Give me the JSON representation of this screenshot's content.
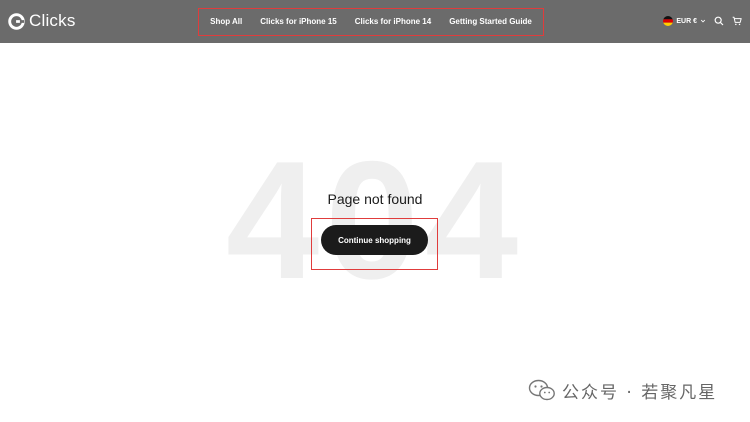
{
  "header": {
    "brand": "Clicks",
    "nav": [
      "Shop All",
      "Clicks for iPhone 15",
      "Clicks for iPhone 14",
      "Getting Started Guide"
    ],
    "currency": "EUR €",
    "icons": {
      "logo": "clicks-logo-icon",
      "flag": "germany-flag-icon",
      "dropdown": "chevron-down-icon",
      "search": "search-icon",
      "cart": "cart-icon"
    }
  },
  "main": {
    "background_code": "404",
    "title": "Page not found",
    "cta_label": "Continue shopping"
  },
  "watermark": {
    "text": "公众号 · 若聚凡星",
    "icon": "wechat-icon"
  },
  "colors": {
    "header_bg": "#6b6b6b",
    "highlight": "#e03c3c",
    "button_bg": "#1b1b1b",
    "ghost_text": "#efefef"
  }
}
